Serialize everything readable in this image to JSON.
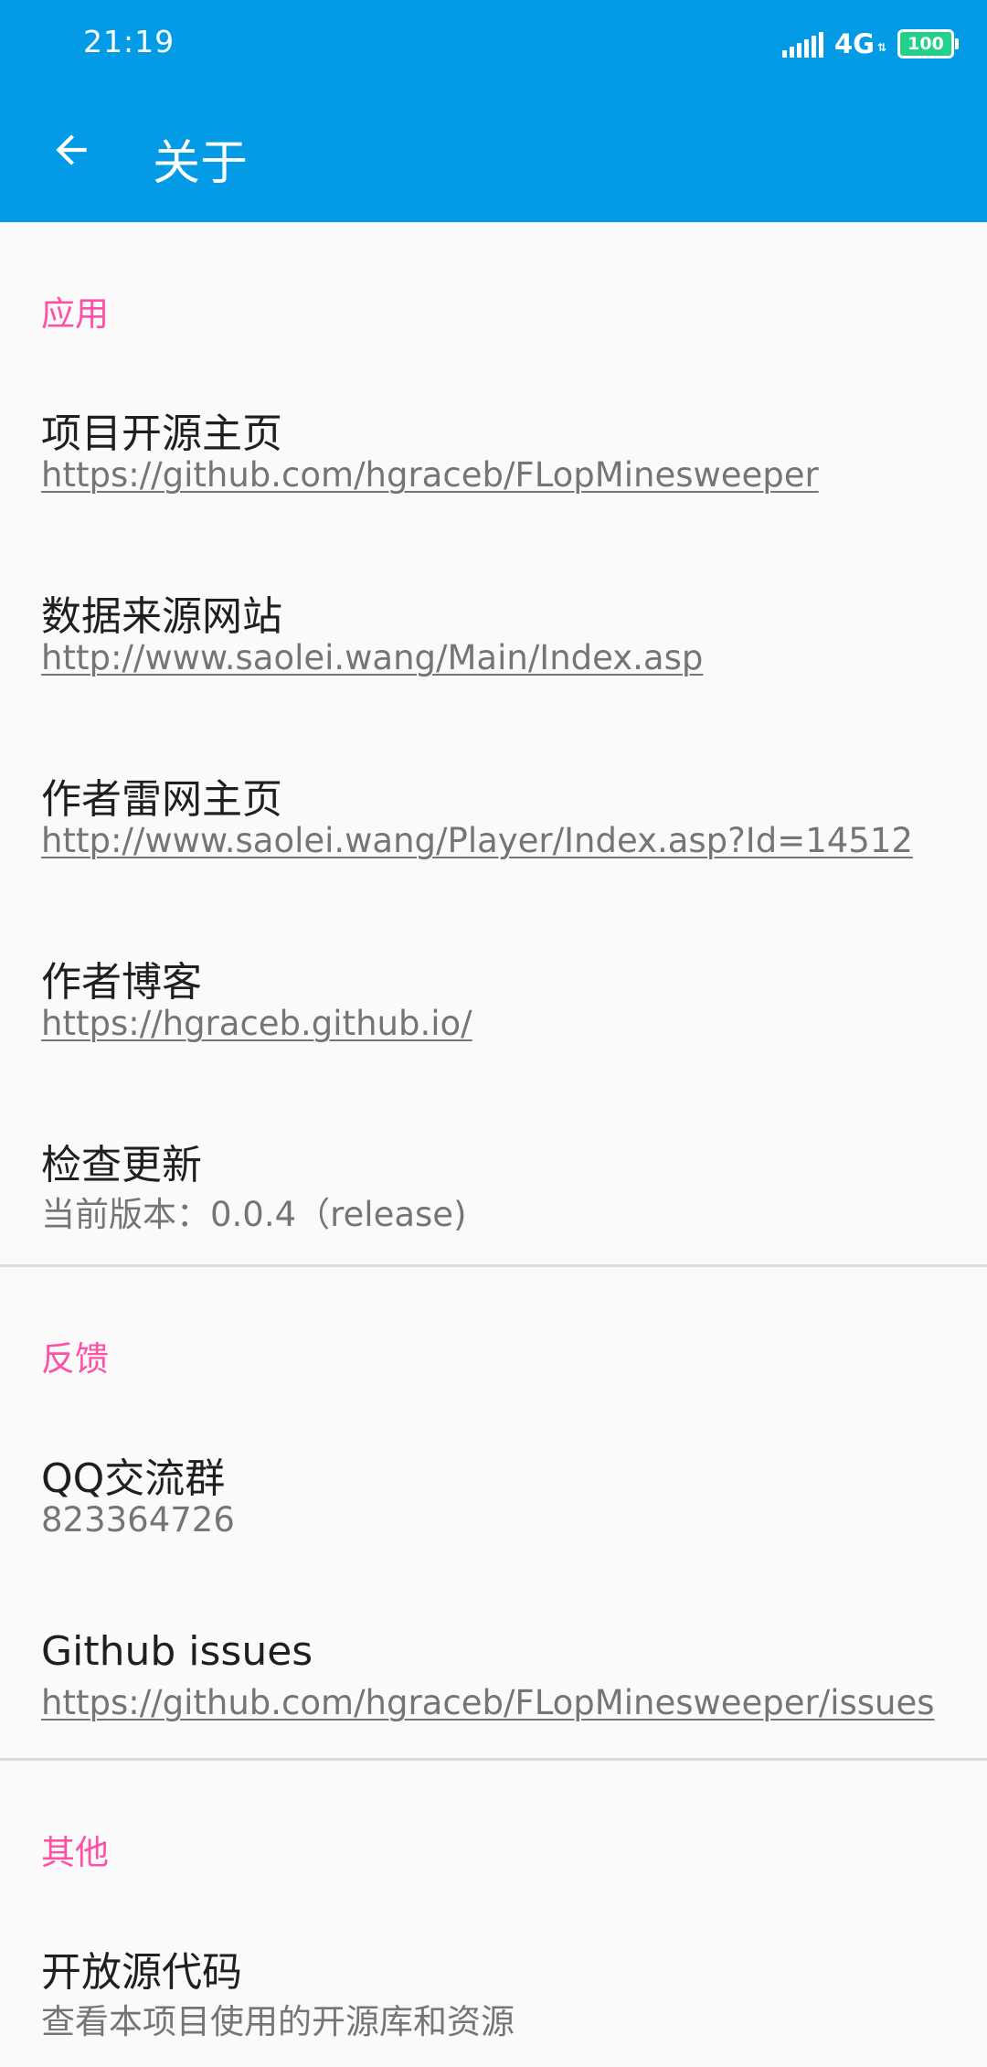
{
  "status_bar": {
    "time": "21:19",
    "network": "4G",
    "battery": "100"
  },
  "toolbar": {
    "title": "关于",
    "back_icon": "arrow-back-icon"
  },
  "colors": {
    "app_bar": "#039be5",
    "section_header": "#ff4fa6",
    "battery": "#22d28a"
  },
  "sections": {
    "app": {
      "header": "应用",
      "items": [
        {
          "title": "项目开源主页",
          "summary": "https://github.com/hgraceb/FLopMinesweeper"
        },
        {
          "title": "数据来源网站",
          "summary": "http://www.saolei.wang/Main/Index.asp"
        },
        {
          "title": "作者雷网主页",
          "summary": "http://www.saolei.wang/Player/Index.asp?Id=14512"
        },
        {
          "title": "作者博客",
          "summary": "https://hgraceb.github.io/"
        },
        {
          "title": "检查更新",
          "summary": "当前版本：0.0.4（release)"
        }
      ]
    },
    "feedback": {
      "header": "反馈",
      "items": [
        {
          "title": "QQ交流群",
          "summary": "823364726"
        },
        {
          "title": "Github issues",
          "summary": "https://github.com/hgraceb/FLopMinesweeper/issues"
        }
      ]
    },
    "other": {
      "header": "其他",
      "items": [
        {
          "title": "开放源代码",
          "summary": "查看本项目使用的开源库和资源"
        }
      ]
    }
  }
}
